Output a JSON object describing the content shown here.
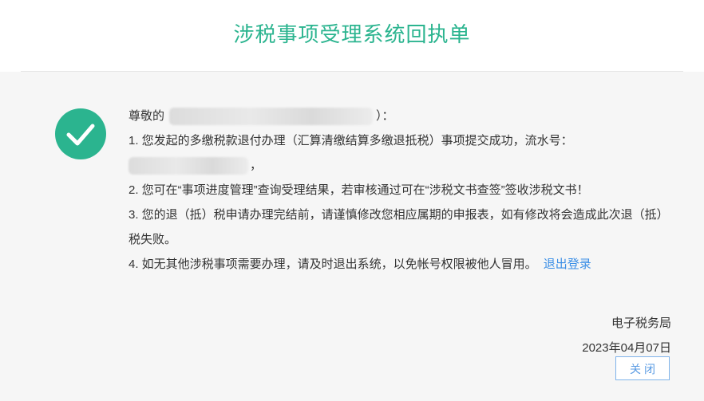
{
  "header": {
    "title": "涉税事项受理系统回执单"
  },
  "status": {
    "icon": "check-icon",
    "color": "#2bb48f"
  },
  "message": {
    "greeting_prefix": "尊敬的",
    "greeting_suffix": "）：",
    "item1_text": "1. 您发起的多缴税款退付办理（汇算清缴结算多缴退抵税）事项提交成功，流水号：",
    "item1_end": "，",
    "item2_text": "2. 您可在“事项进度管理”查询受理结果，若审核通过可在“涉税文书查签”签收涉税文书！",
    "item3_text": "3. 您的退（抵）税申请办理完结前，请谨慎修改您相应属期的申报表，如有修改将会造成此次退（抵）税失败。",
    "item4_text": "4. 如无其他涉税事项需要办理，请及时退出系统，以免帐号权限被他人冒用。",
    "logout_link": "退出登录"
  },
  "footer": {
    "issuer": "电子税务局",
    "date": "2023年04月07日",
    "close_label": "关闭"
  },
  "colors": {
    "accent": "#2bb48f",
    "link": "#3a8ee6"
  }
}
